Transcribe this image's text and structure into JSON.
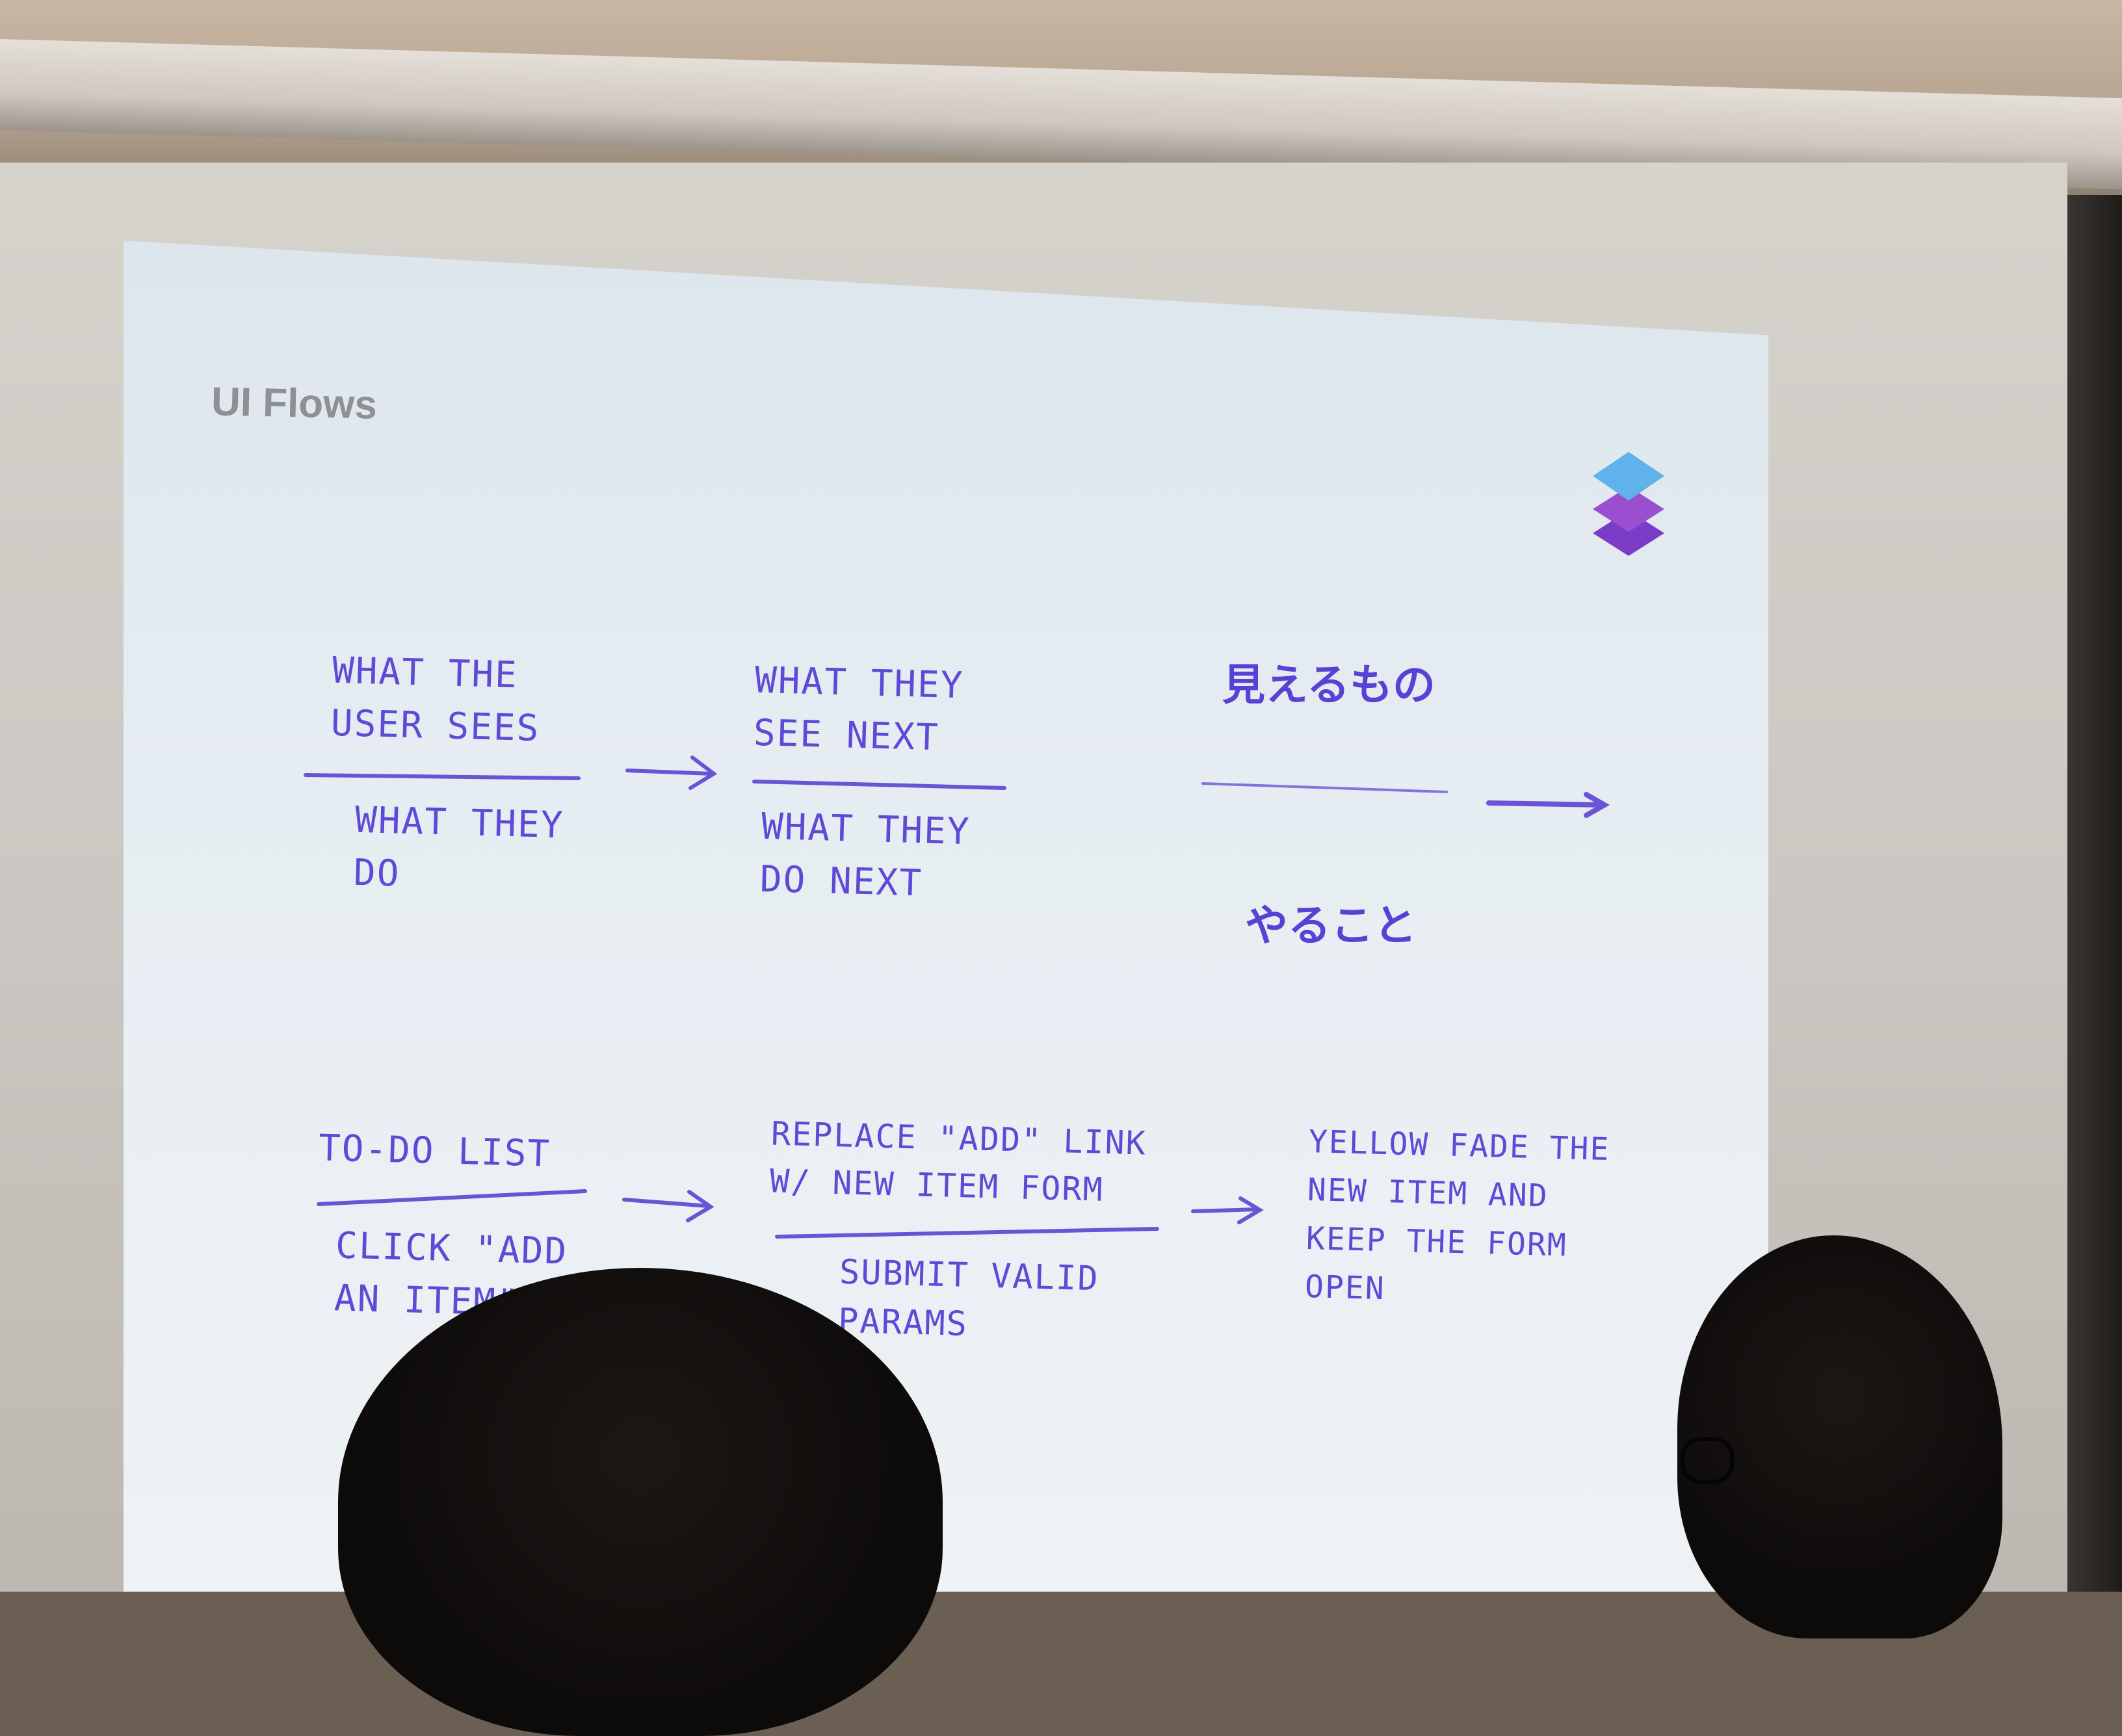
{
  "slide": {
    "title": "UI Flows",
    "logo_icon": "stacked-layers-icon",
    "colors": {
      "ink": "#5c4bd6",
      "logo_top": "#5fb3ea",
      "logo_middle": "#9a4fd0",
      "logo_bottom": "#7a3cc7",
      "accent_line": "#6a54d6"
    }
  },
  "template_row": {
    "step1_top": "WHAT THE\nUSER SEES",
    "step1_bottom": "WHAT THEY\nDO",
    "step2_top": "WHAT THEY\nSEE NEXT",
    "step2_bottom": "WHAT THEY\nDO NEXT",
    "jp_top": "見えるもの",
    "jp_bottom": "やること"
  },
  "example_row": {
    "step1_top": "TO-DO LIST",
    "step1_bottom": "CLICK \"ADD\nAN ITEM\"",
    "step2_top": "REPLACE \"ADD\" LINK\nW/ NEW ITEM FORM",
    "step2_bottom": "SUBMIT VALID\nPARAMS",
    "step3": "YELLOW FADE THE\nNEW ITEM AND\nKEEP THE FORM\nOPEN"
  }
}
